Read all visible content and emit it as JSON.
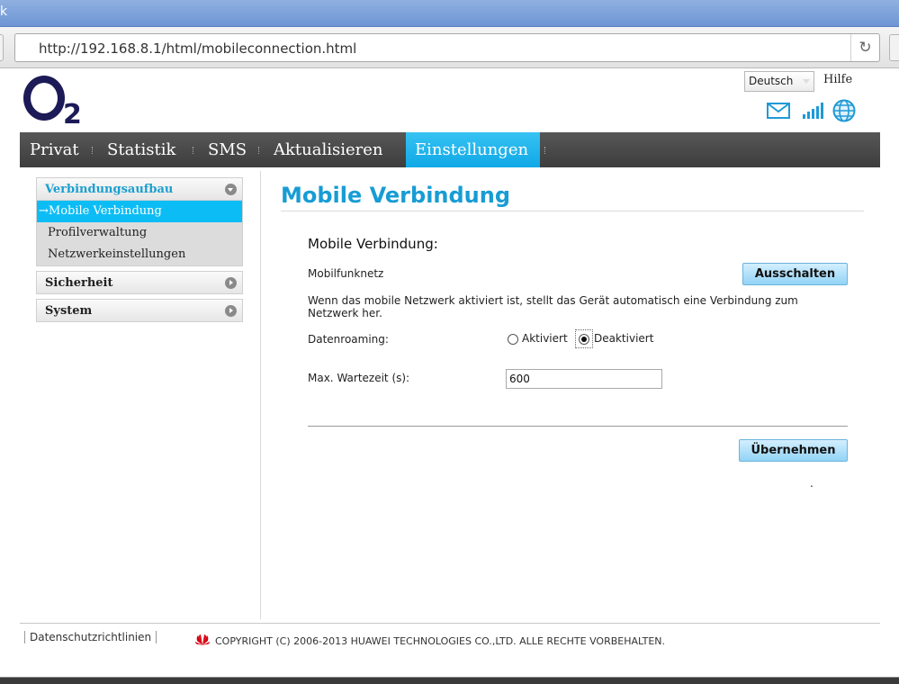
{
  "window": {
    "title": "k"
  },
  "browser": {
    "url": "http://192.168.8.1/html/mobileconnection.html",
    "reload_icon": "reload-icon"
  },
  "header": {
    "brand": {
      "letter": "O",
      "subscript": "2"
    },
    "language_selected": "Deutsch",
    "help": "Hilfe",
    "status_icons": [
      "mail-icon",
      "signal-strength-icon",
      "globe-icon"
    ]
  },
  "nav": {
    "items": [
      "Privat",
      "Statistik",
      "SMS",
      "Aktualisieren",
      "Einstellungen"
    ],
    "active": "Einstellungen"
  },
  "sidebar": {
    "groups": [
      {
        "label": "Verbindungsaufbau",
        "expanded": true,
        "items": [
          "Mobile Verbindung",
          "Profilverwaltung",
          "Netzwerkeinstellungen"
        ],
        "active_item": "→Mobile Verbindung"
      },
      {
        "label": "Sicherheit",
        "expanded": false
      },
      {
        "label": "System",
        "expanded": false
      }
    ]
  },
  "content": {
    "page_title": "Mobile Verbindung",
    "section_title": "Mobile Verbindung:",
    "mobile_network_label": "Mobilfunknetz",
    "mobile_network_button": "Ausschalten",
    "description": "Wenn das mobile Netzwerk aktiviert ist, stellt das Gerät automatisch eine Verbindung zum Netzwerk her.",
    "roaming_label": "Datenroaming:",
    "roaming_options": [
      "Aktiviert",
      "Deaktiviert"
    ],
    "roaming_selected": "Deaktiviert",
    "max_wait_label": "Max. Wartezeit (s):",
    "max_wait_value": "600",
    "apply_button": "Übernehmen",
    "trailing_dot": "."
  },
  "footer": {
    "privacy_link": "Datenschutzrichtlinien",
    "copyright": "COPYRIGHT (C) 2006-2013 HUAWEI TECHNOLOGIES CO.,LTD. ALLE RECHTE VORBEHALTEN.",
    "logo_icon": "huawei-logo-icon"
  },
  "colors": {
    "accent": "#189cd4",
    "nav_active": "#1fb2ec",
    "brand": "#1c1a57",
    "huawei_red": "#d7000f"
  }
}
